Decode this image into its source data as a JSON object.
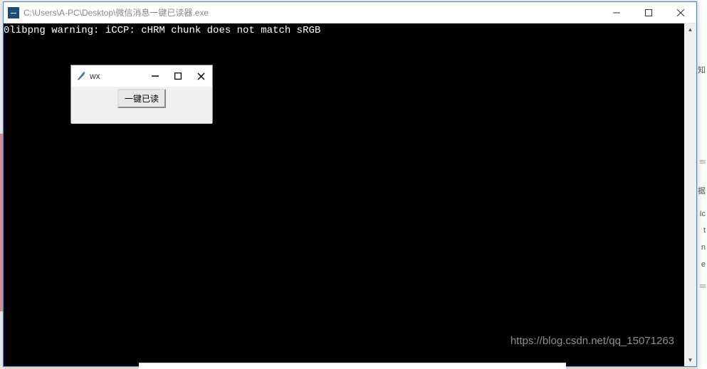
{
  "main_window": {
    "title": "C:\\Users\\A-PC\\Desktop\\微信消息一键已读器.exe"
  },
  "console": {
    "line1": "0libpng warning: iCCP: cHRM chunk does not match sRGB"
  },
  "wx_window": {
    "title": "wx",
    "button_label": "一键已读"
  },
  "watermark": "https://blog.csdn.net/qq_15071263",
  "right_chars": {
    "c1": "知",
    "c2": "据",
    "c3": "Ic",
    "c4": "t",
    "c5": "n"
  }
}
